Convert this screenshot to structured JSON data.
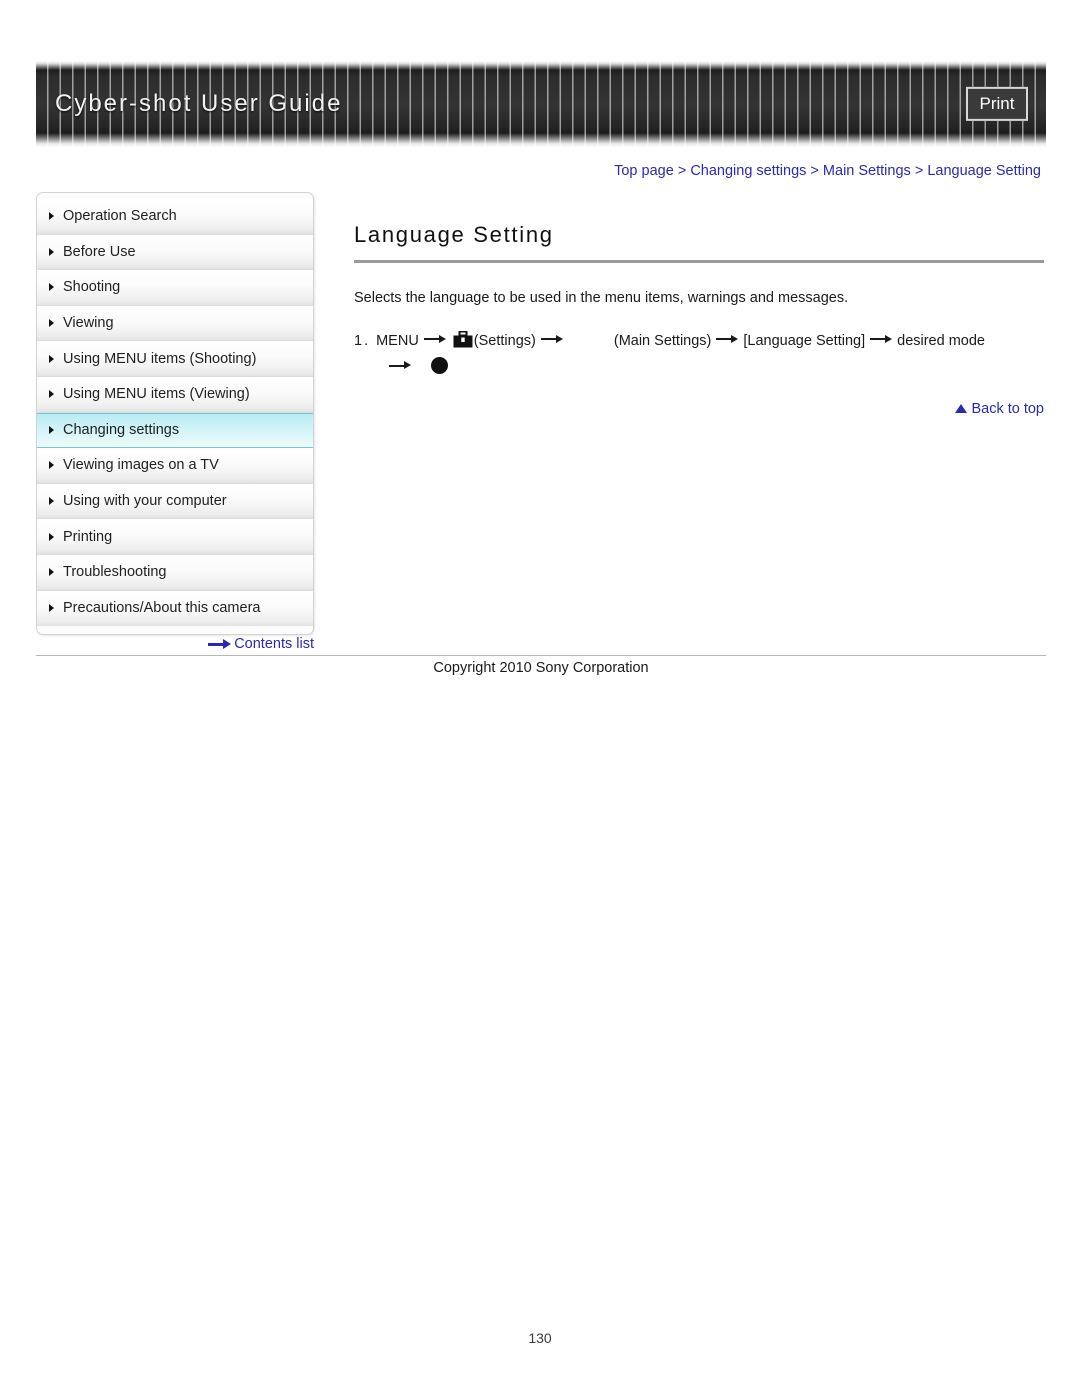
{
  "header": {
    "title": "Cyber-shot User Guide",
    "print_label": "Print"
  },
  "breadcrumb": {
    "separator": ">",
    "items": [
      {
        "label": "Top page"
      },
      {
        "label": "Changing settings"
      },
      {
        "label": "Main Settings"
      },
      {
        "label": "Language Setting"
      }
    ]
  },
  "sidebar": {
    "items": [
      {
        "label": "Operation Search",
        "active": false
      },
      {
        "label": "Before Use",
        "active": false
      },
      {
        "label": "Shooting",
        "active": false
      },
      {
        "label": "Viewing",
        "active": false
      },
      {
        "label": "Using MENU items (Shooting)",
        "active": false
      },
      {
        "label": "Using MENU items (Viewing)",
        "active": false
      },
      {
        "label": "Changing settings",
        "active": true
      },
      {
        "label": "Viewing images on a TV",
        "active": false
      },
      {
        "label": "Using with your computer",
        "active": false
      },
      {
        "label": "Printing",
        "active": false
      },
      {
        "label": "Troubleshooting",
        "active": false
      },
      {
        "label": "Precautions/About this camera",
        "active": false
      }
    ],
    "contents_list_label": "Contents list"
  },
  "main": {
    "page_title": "Language Setting",
    "intro": "Selects the language to be used in the menu items, warnings and messages.",
    "step": {
      "number": "1.",
      "menu_label": "MENU",
      "settings_label": "(Settings)",
      "main_settings_label": "(Main Settings)",
      "language_setting_label": "[Language Setting]",
      "desired_mode_label": "desired mode"
    },
    "back_to_top_label": "Back to top"
  },
  "footer": {
    "copyright": "Copyright 2010 Sony Corporation",
    "page_number": "130"
  },
  "colors": {
    "link": "#2a2ab0",
    "sidebar_active": "#b9ecf4",
    "banner_dark": "#2c2c2c",
    "rule": "#9a9a9a"
  }
}
